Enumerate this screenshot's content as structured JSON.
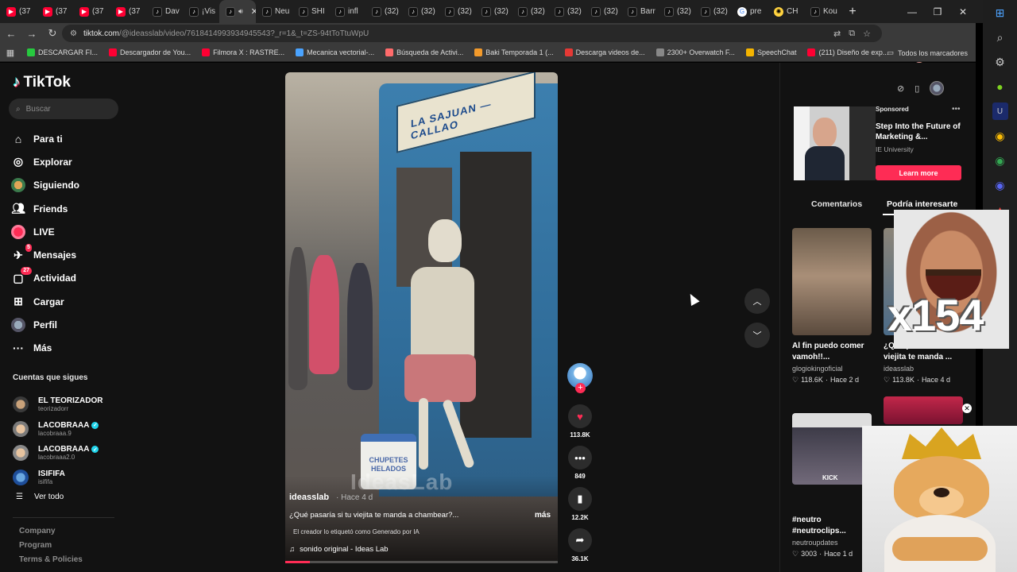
{
  "browser": {
    "tabs": [
      {
        "label": "(37",
        "icon": "youtube-icon"
      },
      {
        "label": "(37",
        "icon": "youtube-icon"
      },
      {
        "label": "(37",
        "icon": "youtube-icon"
      },
      {
        "label": "(37",
        "icon": "youtube-icon"
      },
      {
        "label": "Dav",
        "icon": "tiktok-icon"
      },
      {
        "label": "¡Vis",
        "icon": "tiktok-icon"
      },
      {
        "label": "",
        "icon": "tiktok-icon",
        "active": true
      },
      {
        "label": "Neu",
        "icon": "tiktok-icon"
      },
      {
        "label": "SHI",
        "icon": "tiktok-icon"
      },
      {
        "label": "infl",
        "icon": "tiktok-icon"
      },
      {
        "label": "(32)",
        "icon": "tiktok-icon"
      },
      {
        "label": "(32)",
        "icon": "tiktok-icon"
      },
      {
        "label": "(32)",
        "icon": "tiktok-icon"
      },
      {
        "label": "(32)",
        "icon": "tiktok-icon"
      },
      {
        "label": "(32)",
        "icon": "tiktok-icon"
      },
      {
        "label": "(32)",
        "icon": "tiktok-icon"
      },
      {
        "label": "(32)",
        "icon": "tiktok-icon"
      },
      {
        "label": "Barr",
        "icon": "tiktok-icon"
      },
      {
        "label": "(32)",
        "icon": "tiktok-icon"
      },
      {
        "label": "(32)",
        "icon": "tiktok-icon"
      },
      {
        "label": "pre",
        "icon": "google-icon"
      },
      {
        "label": "CH",
        "icon": "chatgpt-icon"
      },
      {
        "label": "Kou",
        "icon": "tiktok-icon"
      }
    ],
    "url_host": "tiktok.com",
    "url_path": "/@ideasslab/video/7618414993934945543?_r=1&_t=ZS-94tToTtuWpU",
    "bookmarks": [
      {
        "label": "DESCARGAR FI...",
        "color": "#27c93f"
      },
      {
        "label": "Descargador de You...",
        "color": "#ff0033"
      },
      {
        "label": "Filmora X : RASTRE...",
        "color": "#ff0033"
      },
      {
        "label": "Mecanica vectorial-...",
        "color": "#4aa3ff"
      },
      {
        "label": "Búsqueda de Activi...",
        "color": "#ff6b6b"
      },
      {
        "label": "Baki Temporada 1 (...",
        "color": "#f39a2b"
      },
      {
        "label": "Descarga videos de...",
        "color": "#e53935"
      },
      {
        "label": "2300+ Overwatch F...",
        "color": "#888888"
      },
      {
        "label": "SpeechChat",
        "color": "#f4b400"
      },
      {
        "label": "(211) Diseño de exp...",
        "color": "#ff0033"
      }
    ],
    "all_bookmarks": "Todos los marcadores"
  },
  "tiktok": {
    "logo": "TikTok",
    "search_placeholder": "Buscar",
    "nav": [
      {
        "label": "Para ti",
        "icon": "home-icon"
      },
      {
        "label": "Explorar",
        "icon": "compass-icon"
      },
      {
        "label": "Siguiendo",
        "icon": "following-avatar-icon"
      },
      {
        "label": "Friends",
        "icon": "friends-icon"
      },
      {
        "label": "LIVE",
        "icon": "live-icon"
      },
      {
        "label": "Mensajes",
        "icon": "messages-icon",
        "badge": "5"
      },
      {
        "label": "Actividad",
        "icon": "activity-icon",
        "badge": "27"
      },
      {
        "label": "Cargar",
        "icon": "upload-icon"
      },
      {
        "label": "Perfil",
        "icon": "profile-avatar-icon"
      },
      {
        "label": "Más",
        "icon": "more-icon"
      }
    ],
    "following_title": "Cuentas que sigues",
    "following": [
      {
        "name": "EL TEORIZADOR",
        "handle": "teorizadorr",
        "verified": false
      },
      {
        "name": "LACOBRAAA",
        "handle": "lacobraaa.9",
        "verified": true
      },
      {
        "name": "LACOBRAAA",
        "handle": "lacobraaa2.0",
        "verified": true
      },
      {
        "name": "ISIFIFA",
        "handle": "isififa",
        "verified": false
      }
    ],
    "see_all": "Ver todo",
    "footer": [
      "Company",
      "Program",
      "Terms & Policies"
    ],
    "video": {
      "sign_text": "LA SAJUAN — CALLAO",
      "cooler_text": "CHUPETES HELADOS",
      "watermark": "IdeasLab",
      "author": "ideasslab",
      "time": "· Hace 4 d",
      "caption": "¿Qué pasaría si tu viejita te manda a chambear?...",
      "more": "más",
      "ai_label": "El creador lo etiquetó como Generado por IA",
      "sound": "sonido original - Ideas Lab",
      "progress": 0.09
    },
    "actions": {
      "likes": "113.8K",
      "comments": "849",
      "saves": "12.2K",
      "shares": "36.1K"
    },
    "ad": {
      "sponsored": "Sponsored",
      "title": "Step Into the Future of Marketing &...",
      "brand": "IE University",
      "cta": "Learn more"
    },
    "tabs": {
      "comments": "Comentarios",
      "recs": "Podría interesarte"
    },
    "cards": [
      {
        "title": "Al fin puedo comer vamoh!!...",
        "author": "glogiokingoficial",
        "likes": "118.6K",
        "time": "Hace 2 d"
      },
      {
        "title": "¿Qué pasaría si tu viejita te manda ...",
        "author": "ideasslab",
        "likes": "113.8K",
        "time": "Hace 4 d"
      },
      {
        "title": "#neutro #neutroclips...",
        "author": "neutroupdates",
        "likes": "3003",
        "time": "Hace 1 d"
      }
    ],
    "card3_thumb_text": "KICK"
  },
  "overlay": {
    "meme_counter": "x154"
  }
}
